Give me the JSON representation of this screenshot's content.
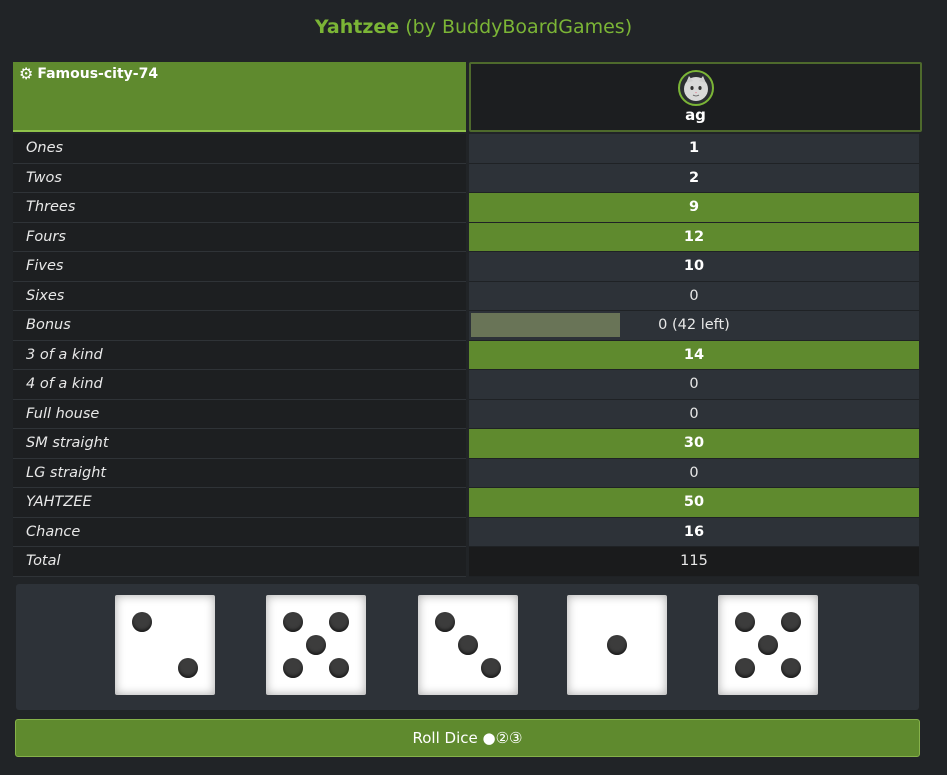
{
  "header": {
    "game_name": "Yahtzee",
    "subtitle": "(by BuddyBoardGames)"
  },
  "player": {
    "room_name": "Famous-city-74",
    "settings_icon": "gear-icon",
    "avatar_icon": "cat-avatar-icon",
    "initials": "ag"
  },
  "scorecard": [
    {
      "label": "Ones",
      "value": "1",
      "bold": true,
      "green": false
    },
    {
      "label": "Twos",
      "value": "2",
      "bold": true,
      "green": false
    },
    {
      "label": "Threes",
      "value": "9",
      "bold": true,
      "green": true
    },
    {
      "label": "Fours",
      "value": "12",
      "bold": true,
      "green": true
    },
    {
      "label": "Fives",
      "value": "10",
      "bold": true,
      "green": false
    },
    {
      "label": "Sixes",
      "value": "0",
      "bold": false,
      "green": false
    },
    {
      "label": "Bonus",
      "value": "0 (42 left)",
      "bold": false,
      "green": false,
      "progress": 0.33
    },
    {
      "label": "3 of a kind",
      "value": "14",
      "bold": true,
      "green": true
    },
    {
      "label": "4 of a kind",
      "value": "0",
      "bold": false,
      "green": false
    },
    {
      "label": "Full house",
      "value": "0",
      "bold": false,
      "green": false
    },
    {
      "label": "SM straight",
      "value": "30",
      "bold": true,
      "green": true
    },
    {
      "label": "LG straight",
      "value": "0",
      "bold": false,
      "green": false
    },
    {
      "label": "YAHTZEE",
      "value": "50",
      "bold": true,
      "green": true
    },
    {
      "label": "Chance",
      "value": "16",
      "bold": true,
      "green": false
    },
    {
      "label": "Total",
      "value": "115",
      "bold": false,
      "green": false,
      "total": true
    }
  ],
  "dice": [
    2,
    5,
    3,
    1,
    5
  ],
  "roll_button": {
    "label": "Roll Dice ●②③"
  },
  "colors": {
    "accent_green": "#5f8a2e",
    "title_green": "#7bb536",
    "background": "#212427"
  }
}
